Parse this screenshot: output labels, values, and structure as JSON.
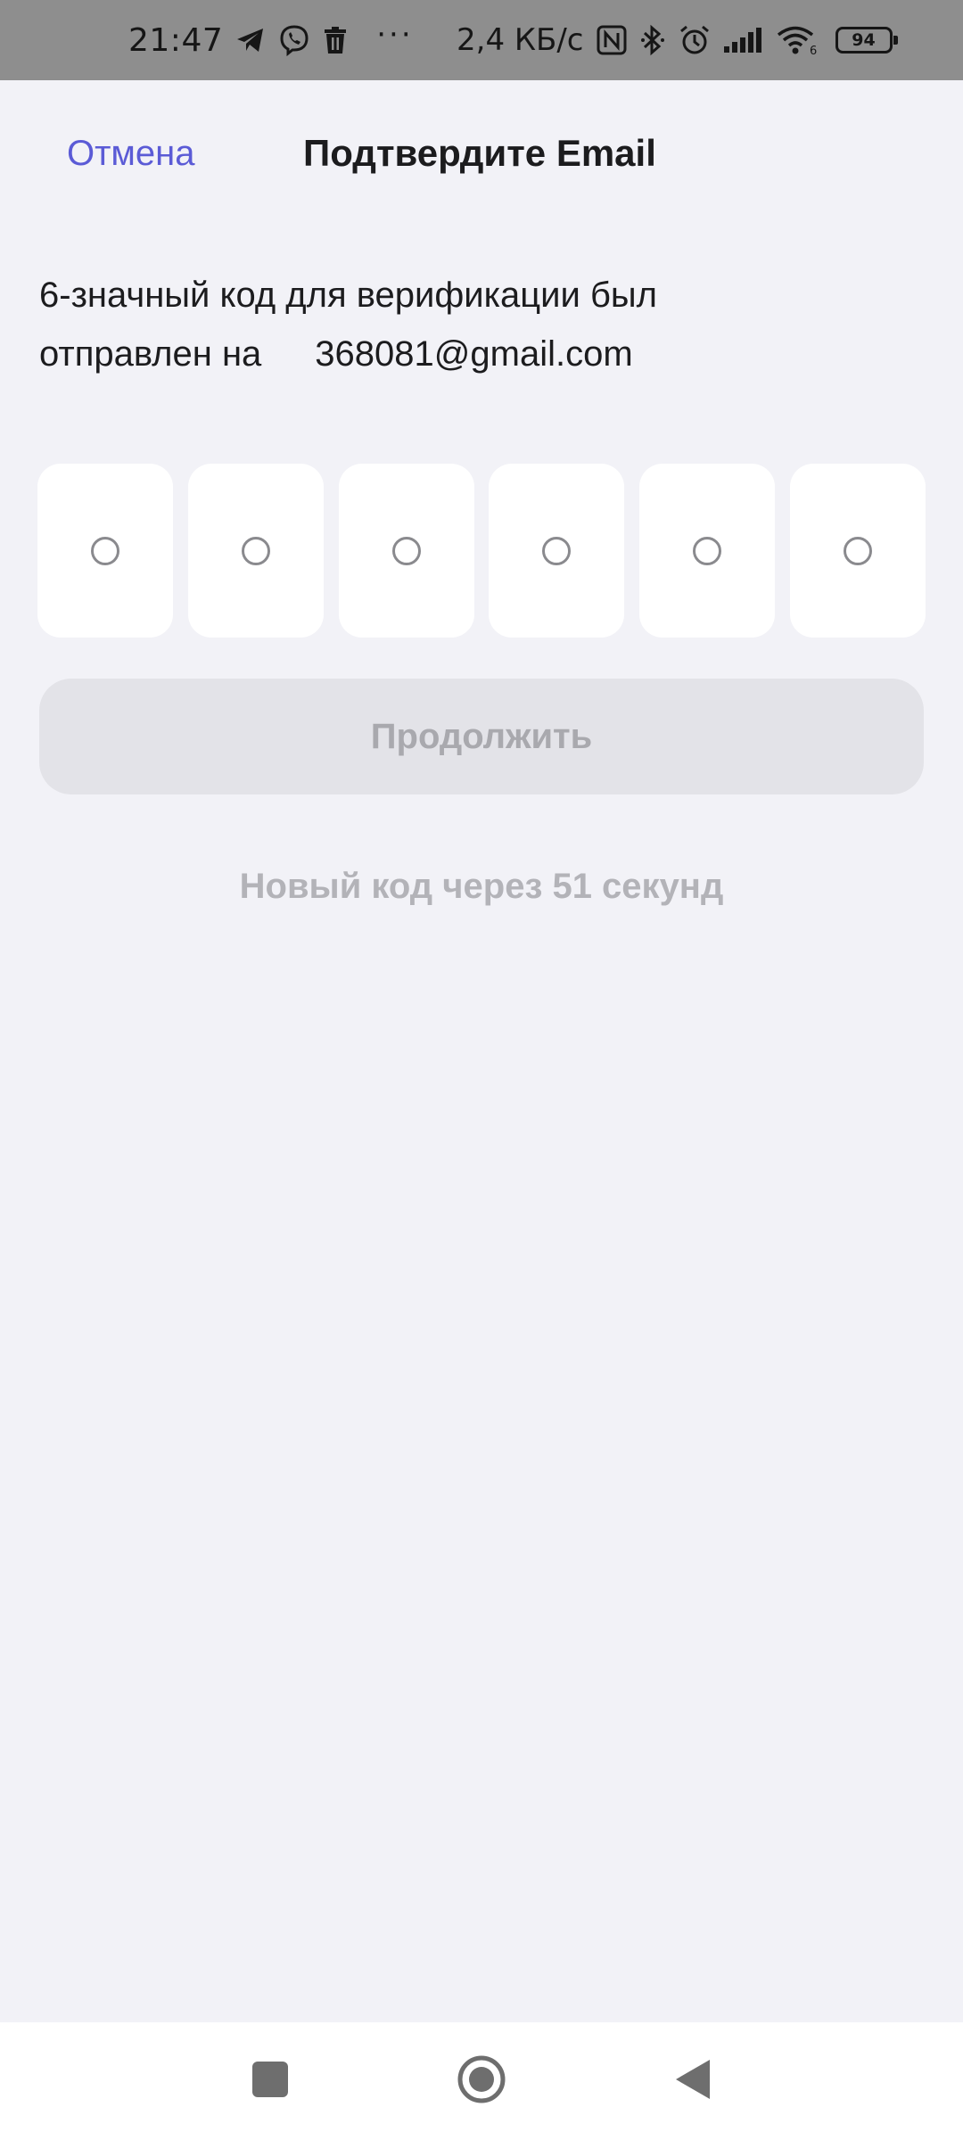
{
  "status_bar": {
    "time": "21:47",
    "network_speed": "2,4 КБ/с",
    "more": "···",
    "battery": "94",
    "icons": [
      "telegram-icon",
      "viber-icon",
      "trash-icon",
      "nfc-icon",
      "bluetooth-icon",
      "alarm-icon",
      "signal-icon",
      "wifi-icon",
      "battery-icon"
    ]
  },
  "header": {
    "cancel_label": "Отмена",
    "title": "Подтвердите Email"
  },
  "description": {
    "line1": "6-значный код для верификации был",
    "line2_prefix": "отправлен на",
    "email": "368081@gmail.com"
  },
  "code": {
    "length": 6,
    "digits": [
      "",
      "",
      "",
      "",
      "",
      ""
    ]
  },
  "continue_label": "Продолжить",
  "resend_text": "Новый код через 51 секунд",
  "nav_bar": {
    "icons": [
      "recents-icon",
      "home-icon",
      "back-icon"
    ]
  },
  "colors": {
    "accent": "#5b5bd6",
    "background": "#f2f2f7",
    "disabled_button": "#e3e3e8",
    "disabled_text": "#a9a9ae"
  }
}
